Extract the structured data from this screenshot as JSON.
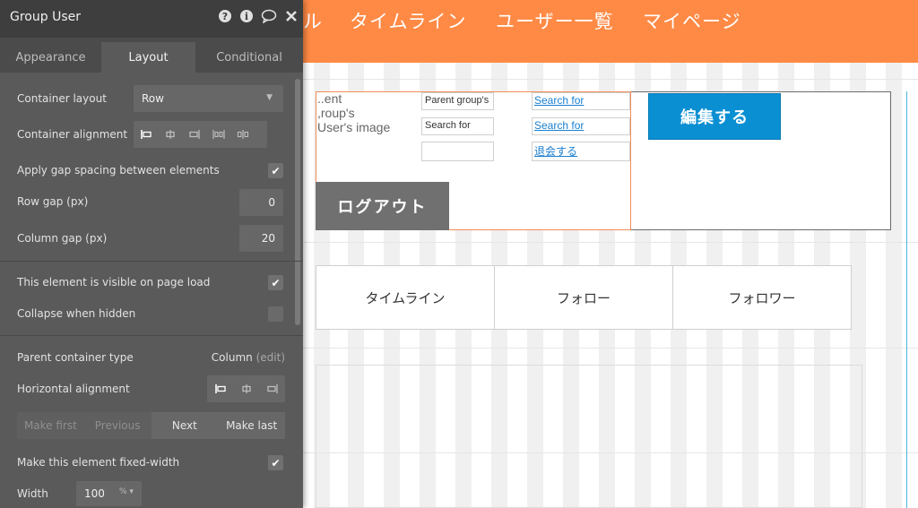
{
  "app": {
    "nav_items": [
      "ル",
      "タイムライン",
      "ユーザー一覧",
      "マイページ"
    ]
  },
  "canvas": {
    "image_placeholder_lines": [
      "..ent",
      ",roup's",
      "User's image"
    ],
    "parent_group_label": "Parent group's",
    "search_for_label": "Search for",
    "link_search_1": "Search for",
    "link_search_2": "Search for",
    "link_withdraw": "退会する",
    "edit_button": "編集する",
    "logout_button": "ログアウト",
    "tabs": [
      "タイムライン",
      "フォロー",
      "フォロワー"
    ]
  },
  "panel": {
    "title": "Group User",
    "title_icons": [
      "help-icon",
      "info-icon",
      "comment-icon",
      "close-icon"
    ],
    "tabs": [
      "Appearance",
      "Layout",
      "Conditional"
    ],
    "active_tab": "Layout",
    "container_layout_label": "Container layout",
    "container_layout_value": "Row",
    "container_alignment_label": "Container alignment",
    "gap_spacing_label": "Apply gap spacing between elements",
    "gap_spacing_checked": true,
    "row_gap_label": "Row gap (px)",
    "row_gap_value": "0",
    "column_gap_label": "Column gap (px)",
    "column_gap_value": "20",
    "visible_on_load_label": "This element is visible on page load",
    "visible_on_load_checked": true,
    "collapse_hidden_label": "Collapse when hidden",
    "collapse_hidden_checked": false,
    "parent_container_type_label": "Parent container type",
    "parent_container_type_value": "Column",
    "parent_container_type_edit": "(edit)",
    "horizontal_alignment_label": "Horizontal alignment",
    "order_buttons": [
      "Make first",
      "Previous",
      "Next",
      "Make last"
    ],
    "fixed_width_label": "Make this element fixed-width",
    "fixed_width_checked": true,
    "width_label": "Width",
    "width_value": "100",
    "width_unit": "%"
  },
  "colors": {
    "header_orange": "#ff8a45",
    "edit_blue": "#0b8fd3",
    "logout_gray": "#707070",
    "panel_dark": "#4b4b4b"
  }
}
